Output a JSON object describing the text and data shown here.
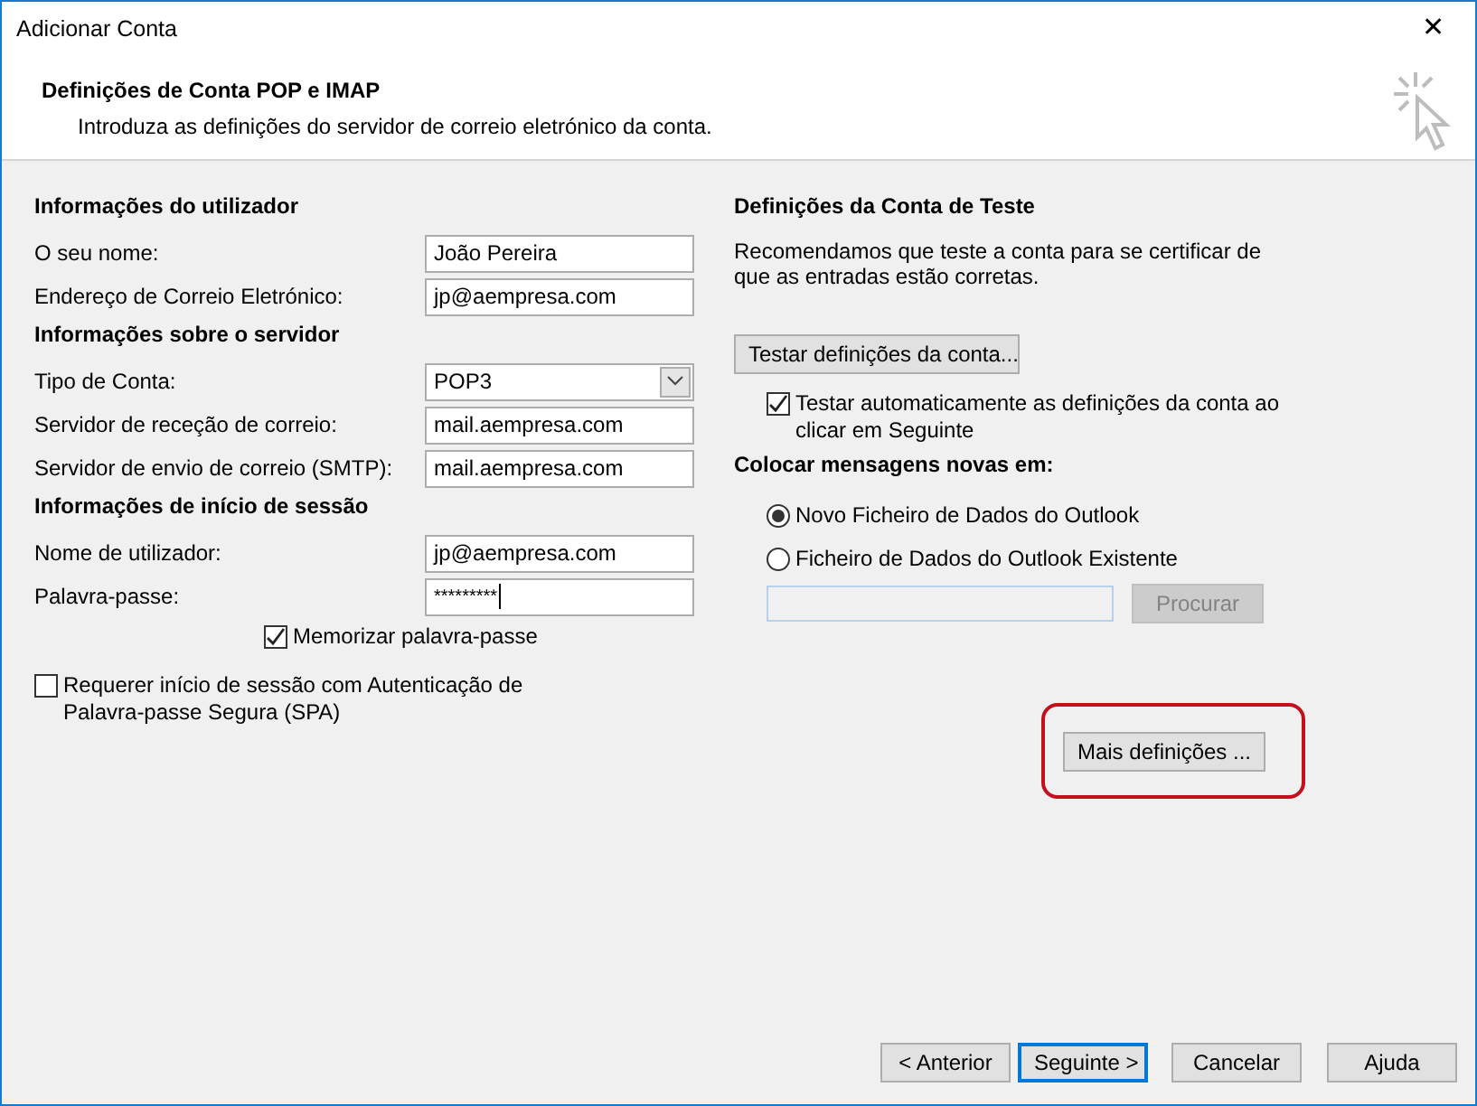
{
  "window": {
    "title": "Adicionar Conta",
    "close": "✕"
  },
  "header": {
    "title": "Definições de Conta POP e IMAP",
    "subtitle": "Introduza as definições do servidor de correio eletrónico da conta."
  },
  "sections": [
    {
      "heading": "Informações do utilizador",
      "fields": [
        {
          "label": "O seu nome:",
          "kind": "text",
          "value": "João Pereira"
        },
        {
          "label": "Endereço de Correio Eletrónico:",
          "kind": "text",
          "value": "jp@aempresa.com"
        }
      ]
    },
    {
      "heading": "Informações sobre o servidor",
      "fields": [
        {
          "label": "Tipo de Conta:",
          "kind": "dropdown",
          "value": "POP3"
        },
        {
          "label": "Servidor de receção de correio:",
          "kind": "text",
          "value": "mail.aempresa.com"
        },
        {
          "label": "Servidor de envio de correio (SMTP):",
          "kind": "text",
          "value": "mail.aempresa.com"
        }
      ]
    },
    {
      "heading": "Informações de início de sessão",
      "fields": [
        {
          "label": "Nome de utilizador:",
          "kind": "text",
          "value": "jp@aempresa.com"
        },
        {
          "label": "Palavra-passe:",
          "kind": "password",
          "value": "*********"
        }
      ]
    }
  ],
  "remember_password": {
    "label": "Memorizar palavra-passe",
    "checked": true
  },
  "require_spa": {
    "label": "Requerer início de sessão com Autenticação de Palavra-passe Segura (SPA)",
    "checked": false
  },
  "test": {
    "heading": "Definições da Conta de Teste",
    "description": "Recomendamos que teste a conta para se certificar de que as entradas estão corretas.",
    "button": "Testar definições da conta...",
    "auto_test": {
      "label": "Testar automaticamente as definições da conta ao clicar em Seguinte",
      "checked": true
    }
  },
  "deliver": {
    "heading": "Colocar mensagens novas em:",
    "options": [
      {
        "label": "Novo Ficheiro de Dados do Outlook",
        "selected": true
      },
      {
        "label": "Ficheiro de Dados do Outlook Existente",
        "selected": false
      }
    ],
    "browse_button": {
      "label": "Procurar",
      "disabled": true
    }
  },
  "more_settings": {
    "label": "Mais definições ...",
    "highlighted": true
  },
  "footer_buttons": [
    {
      "label": "< Anterior",
      "default": false
    },
    {
      "label": "Seguinte >",
      "default": true
    },
    {
      "label": "Cancelar",
      "default": false
    },
    {
      "label": "Ajuda",
      "default": false
    }
  ]
}
